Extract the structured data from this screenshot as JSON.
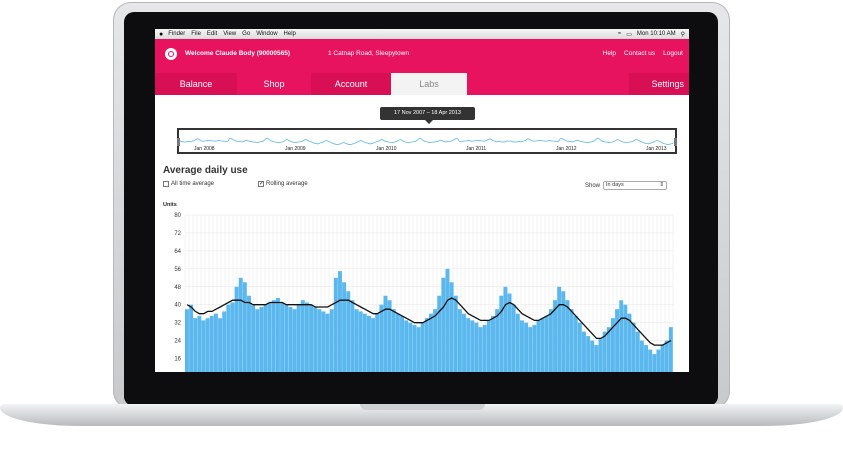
{
  "menubar": {
    "apple": "",
    "items": [
      "Finder",
      "File",
      "Edit",
      "View",
      "Go",
      "Window",
      "Help"
    ],
    "clock": "Mon 10:10 AM"
  },
  "header": {
    "welcome": "Welcome Claude Body (90000565)",
    "address": "1 Catnap Road, Sleepytown",
    "links": {
      "help": "Help",
      "contact": "Contact us",
      "logout": "Logout"
    }
  },
  "tabs": {
    "balance": "Balance",
    "shop": "Shop",
    "account": "Account",
    "labs": "Labs",
    "settings": "Settings"
  },
  "range": {
    "label": "17 Nov 2007 – 18 Apr 2013",
    "nav_years": [
      "Jan 2008",
      "Jan 2009",
      "Jan 2010",
      "Jan 2011",
      "Jan 2012",
      "Jan 2013"
    ]
  },
  "panel": {
    "title": "Average daily use",
    "all_time_label": "All time average",
    "rolling_label": "Rolling average",
    "show_label": "Show",
    "show_value": "In days"
  },
  "chart_data": {
    "type": "bar",
    "ylabel": "Units",
    "yticks": [
      80,
      72,
      64,
      56,
      48,
      40,
      32,
      24,
      16
    ],
    "ylim": [
      10,
      80
    ],
    "bar_color": "#5bb8ee",
    "line_color": "#111111",
    "series": [
      {
        "values": [
          38,
          40,
          34,
          35,
          33,
          34,
          35,
          36,
          34,
          37,
          40,
          41,
          48,
          52,
          50,
          44,
          40,
          38,
          39,
          40,
          41,
          42,
          43,
          41,
          40,
          39,
          38,
          40,
          42,
          41,
          40,
          39,
          38,
          37,
          36,
          38,
          52,
          55,
          50,
          46,
          42,
          38,
          37,
          36,
          35,
          34,
          36,
          40,
          44,
          42,
          38,
          36,
          35,
          33,
          32,
          31,
          30,
          32,
          34,
          36,
          38,
          44,
          52,
          56,
          50,
          44,
          38,
          36,
          34,
          33,
          32,
          30,
          31,
          33,
          35,
          38,
          44,
          48,
          45,
          40,
          36,
          33,
          32,
          30,
          31,
          33,
          34,
          35,
          38,
          42,
          48,
          46,
          42,
          38,
          35,
          32,
          28,
          26,
          24,
          22,
          25,
          28,
          30,
          34,
          38,
          42,
          40,
          36,
          32,
          28,
          24,
          22,
          20,
          18,
          20,
          22,
          24,
          30
        ]
      },
      {
        "values": [
          40,
          39,
          37,
          36,
          36,
          37,
          37,
          38,
          39,
          40,
          41,
          42,
          42,
          42,
          41,
          41,
          40,
          40,
          40,
          40,
          41,
          41,
          41,
          41,
          40,
          40,
          40,
          40,
          40,
          40,
          40,
          39,
          39,
          39,
          39,
          40,
          41,
          42,
          42,
          42,
          41,
          40,
          39,
          38,
          37,
          36,
          36,
          37,
          38,
          38,
          37,
          36,
          35,
          34,
          33,
          32,
          32,
          32,
          33,
          34,
          35,
          37,
          39,
          42,
          43,
          42,
          40,
          38,
          36,
          35,
          34,
          33,
          33,
          33,
          34,
          35,
          37,
          40,
          41,
          40,
          38,
          36,
          35,
          34,
          33,
          33,
          34,
          35,
          36,
          38,
          40,
          40,
          39,
          37,
          35,
          33,
          31,
          29,
          27,
          25,
          25,
          26,
          28,
          30,
          32,
          34,
          34,
          33,
          31,
          29,
          27,
          25,
          23,
          22,
          22,
          22,
          23,
          24
        ]
      }
    ]
  }
}
